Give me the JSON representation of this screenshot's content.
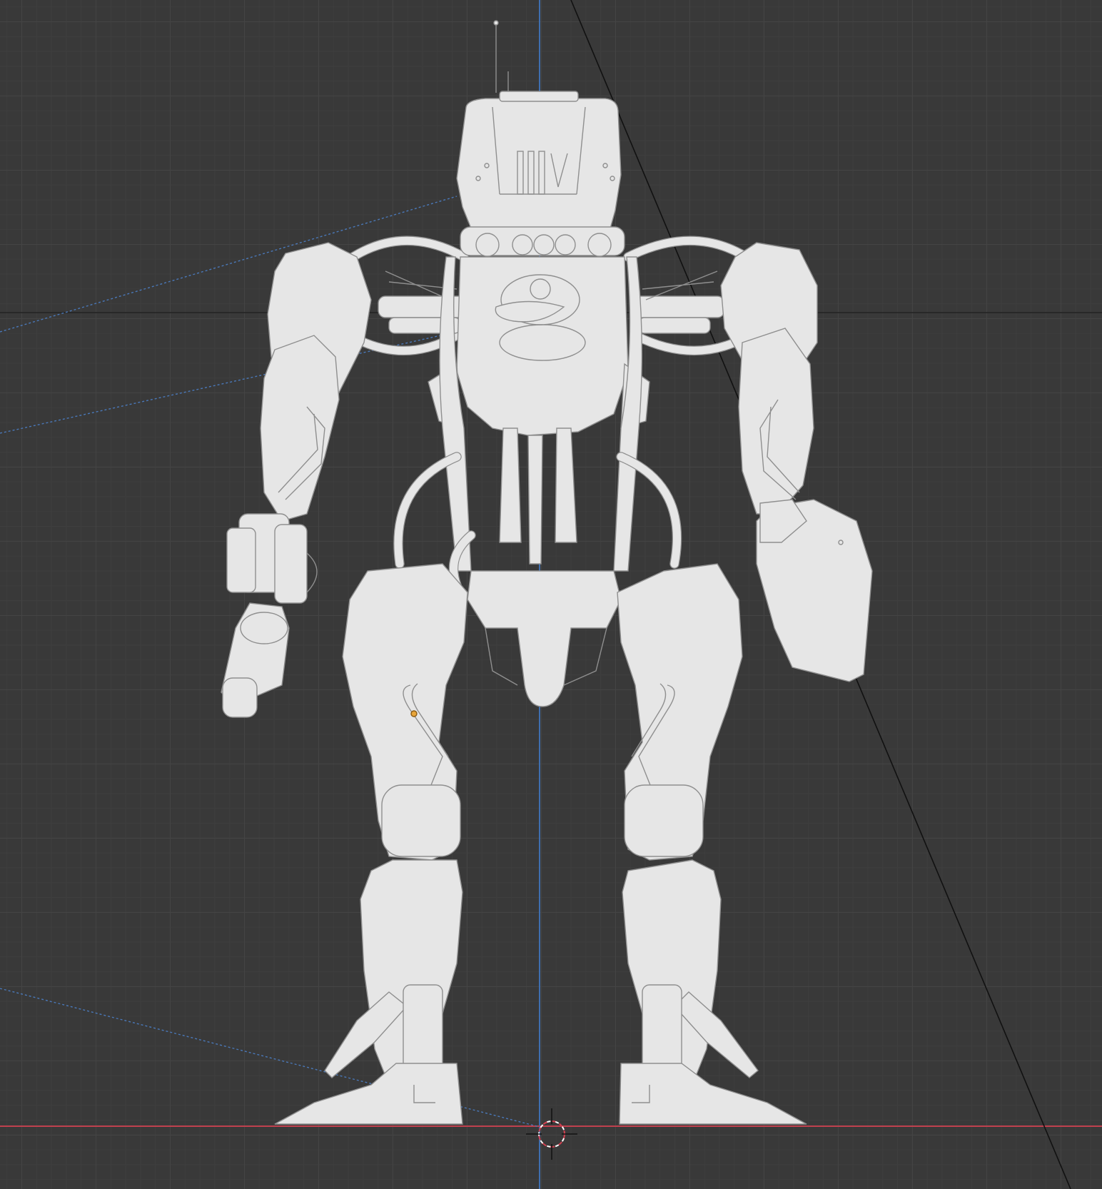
{
  "viewport": {
    "view": "orthographic-back",
    "grid": true,
    "background_color": "#393939",
    "grid_color": "#444444",
    "axis_x_color": "#c0404e",
    "axis_z_color": "#3f6fb0",
    "object_color": "#e6e6e6",
    "outline_color": "#8f8f8f",
    "origin_marker_color": "#e8a53a"
  },
  "scene_object": {
    "type": "mech-robot-model",
    "icon": "robot-icon"
  },
  "cursor": {
    "icon": "3d-cursor-icon"
  }
}
